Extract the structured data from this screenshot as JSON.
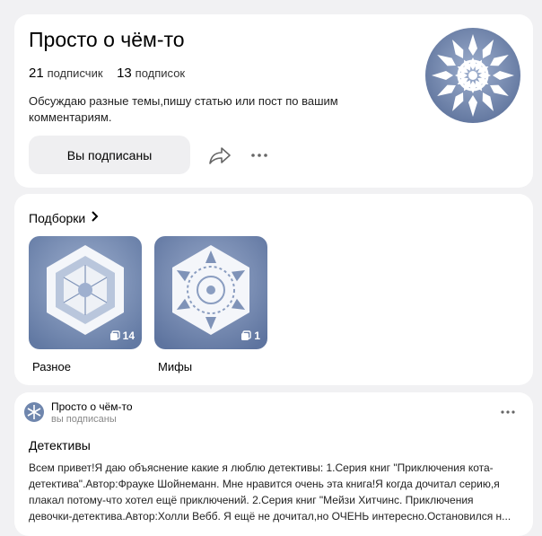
{
  "profile": {
    "title": "Просто о чём-то",
    "subscribers_count": "21",
    "subscribers_label": "подписчик",
    "subscriptions_count": "13",
    "subscriptions_label": "подписок",
    "description": "Обсуждаю разные темы,пишу статью или пост по вашим комментариям.",
    "subscribe_button": "Вы подписаны",
    "avatar_icon": "snowflake-avatar",
    "share_icon": "share-icon",
    "more_icon": "more-vertical-icon"
  },
  "collections": {
    "title": "Подборки",
    "items": [
      {
        "name": "Разное",
        "count": "14"
      },
      {
        "name": "Мифы",
        "count": "1"
      }
    ]
  },
  "post": {
    "author": "Просто о чём-то",
    "status": "вы подписаны",
    "title": "Детективы",
    "lines": [
      "Всем привет!Я даю объяснение какие я люблю детективы: 1.Серия книг \"Приключения кота-",
      "детектива\".Автор:Фрауке Шойнеманн. Мне нравится очень эта книга!Я когда дочитал серию,я",
      "плакал потому-что хотел ещё приключений. 2.Серия книг \"Мейзи Хитчинс. Приключения",
      "девочки-детектива.Автор:Холли Вебб. Я ещё не дочитал,но ОЧЕНЬ интересно.Остановился н..."
    ]
  },
  "colors": {
    "background": "#f1f1f3",
    "card": "#ffffff",
    "button": "#efeff1",
    "snowflake_bg": "#6f86ad"
  }
}
